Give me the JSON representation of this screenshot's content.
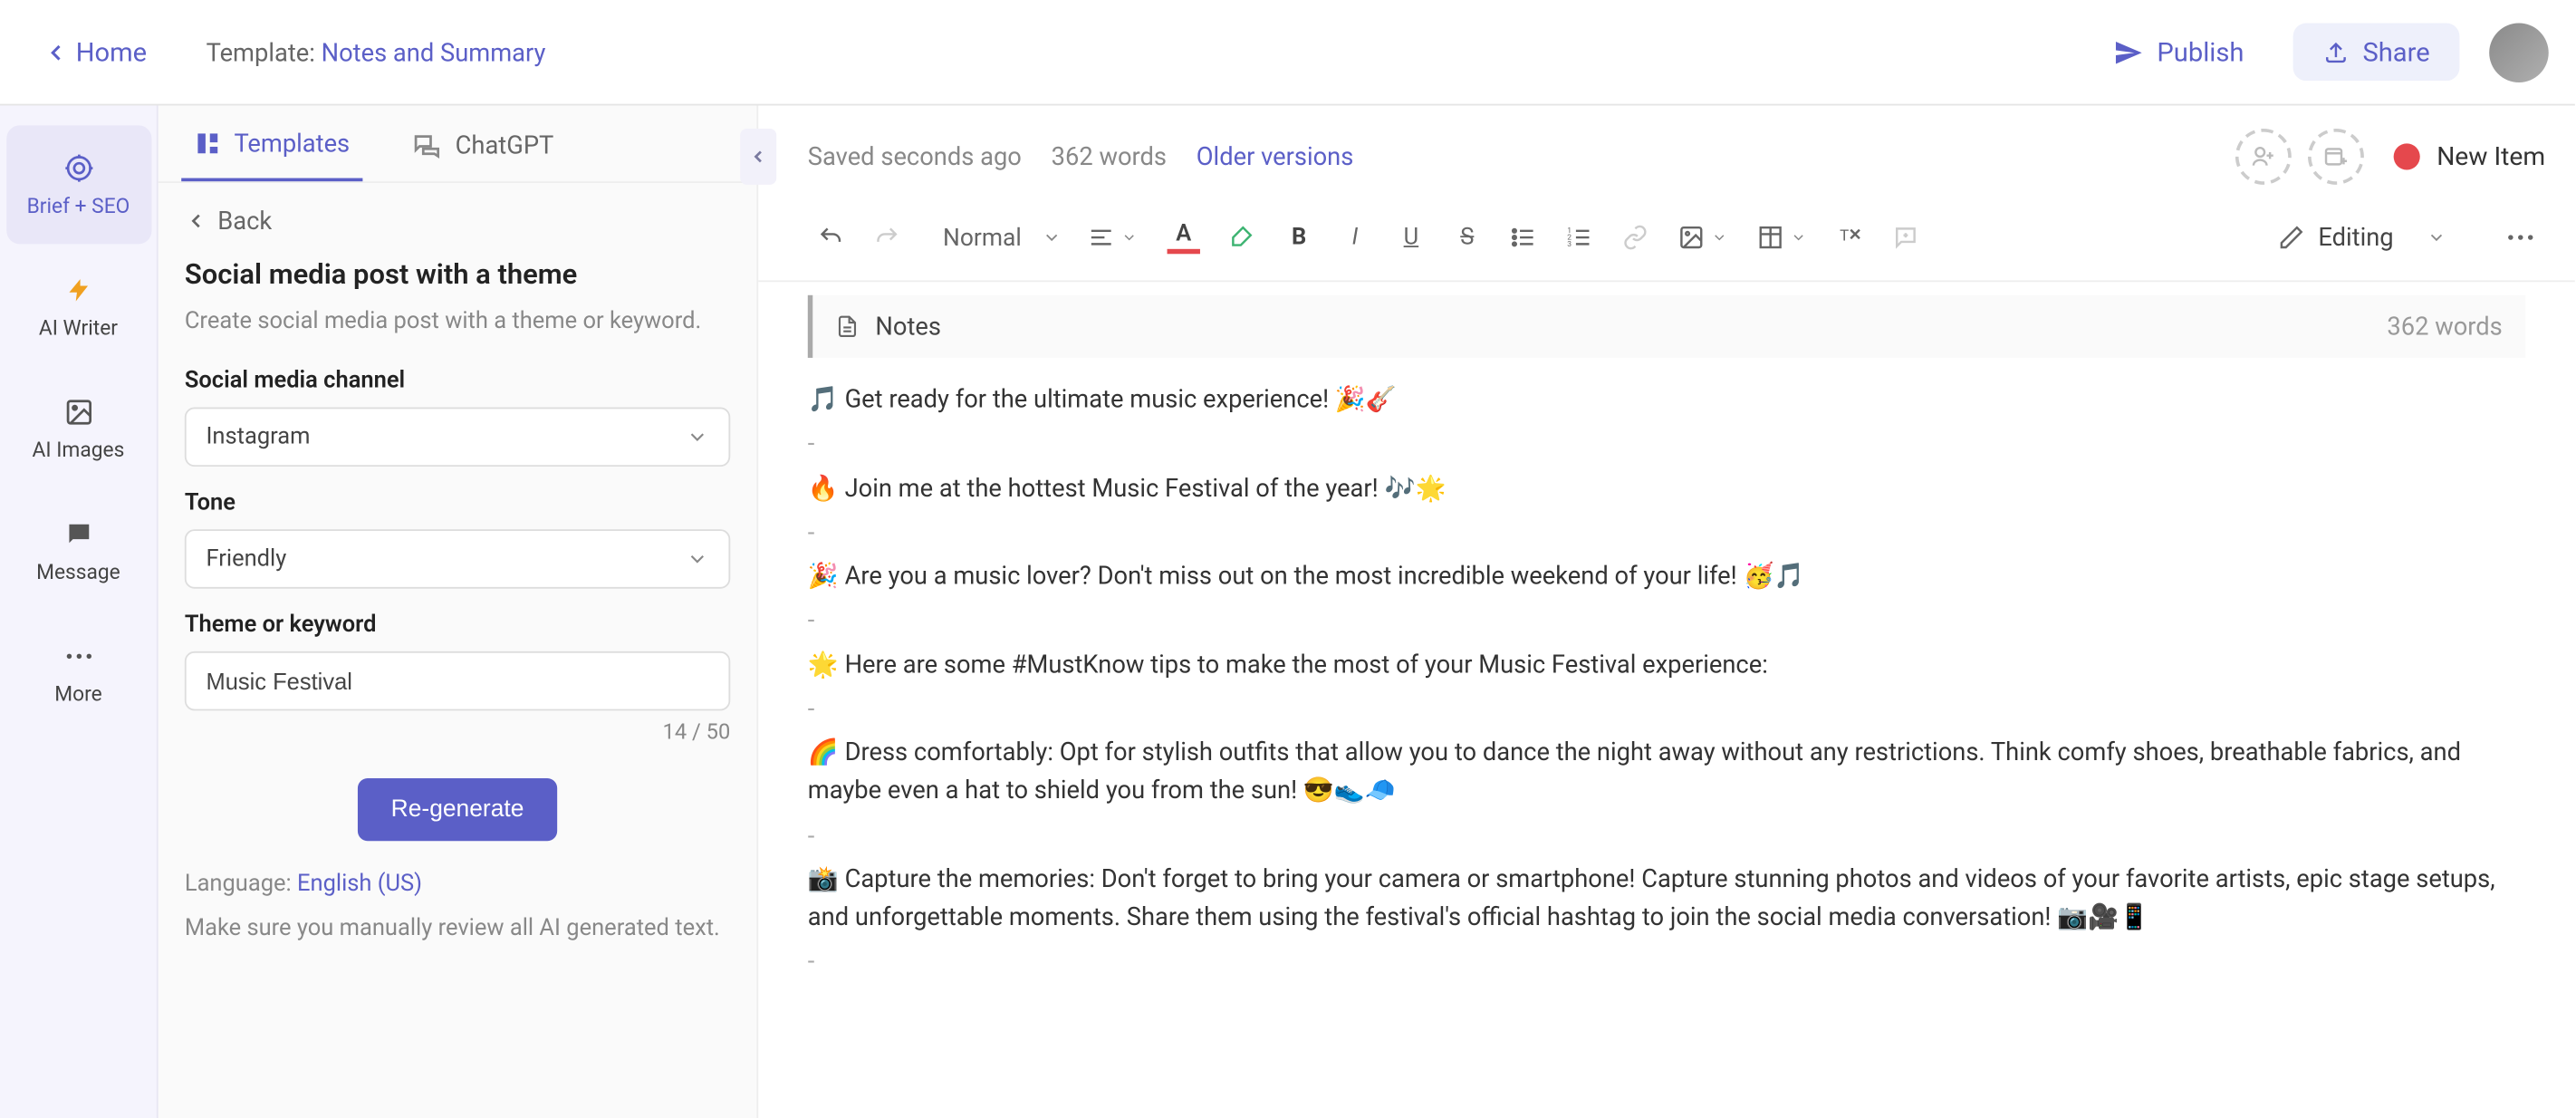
{
  "topbar": {
    "home": "Home",
    "template_label": "Template: ",
    "template_name": "Notes and Summary",
    "publish": "Publish",
    "share": "Share"
  },
  "rail": {
    "items": [
      {
        "label": "Brief + SEO"
      },
      {
        "label": "AI Writer"
      },
      {
        "label": "AI Images"
      },
      {
        "label": "Message"
      },
      {
        "label": "More"
      }
    ]
  },
  "panel": {
    "tabs": {
      "templates": "Templates",
      "chatgpt": "ChatGPT"
    },
    "back": "Back",
    "title": "Social media post with a theme",
    "desc": "Create social media post with a theme or keyword.",
    "field_channel_label": "Social media channel",
    "field_channel_value": "Instagram",
    "field_tone_label": "Tone",
    "field_tone_value": "Friendly",
    "field_keyword_label": "Theme or keyword",
    "field_keyword_value": "Music Festival",
    "char_count": "14 / 50",
    "regenerate": "Re-generate",
    "language_label": "Language: ",
    "language_value": "English (US)",
    "review_note": "Make sure you manually review all AI generated text."
  },
  "editor": {
    "saved": "Saved seconds ago",
    "word_count_meta": "362 words",
    "older_versions": "Older versions",
    "new_item": "New Item",
    "style_normal": "Normal",
    "editing_label": "Editing",
    "notes_label": "Notes",
    "notes_word_count": "362 words"
  },
  "content": {
    "l1": "🎵 Get ready for the ultimate music experience! 🎉🎸",
    "l2": "🔥 Join me at the hottest Music Festival of the year! 🎶🌟",
    "l3": "🎉 Are you a music lover? Don't miss out on the most incredible weekend of your life! 🥳🎵",
    "l4": "🌟 Here are some #MustKnow tips to make the most of your Music Festival experience:",
    "l5": "🌈 Dress comfortably: Opt for stylish outfits that allow you to dance the night away without any restrictions. Think comfy shoes, breathable fabrics, and maybe even a hat to shield you from the sun! 😎👟🧢",
    "l6": "📸 Capture the memories: Don't forget to bring your camera or smartphone! Capture stunning photos and videos of your favorite artists, epic stage setups, and unforgettable moments. Share them using the festival's official hashtag to join the social media conversation! 📷🎥📱",
    "sep": "-"
  }
}
